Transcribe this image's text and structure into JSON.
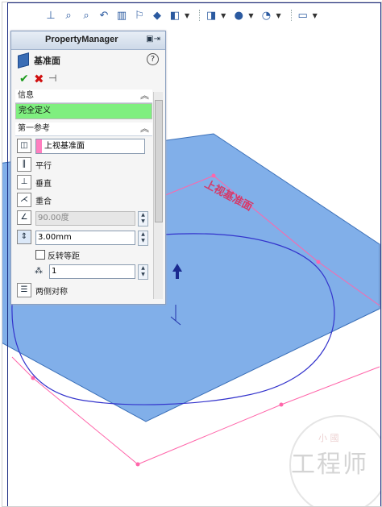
{
  "toolbar": {
    "icons": [
      "view-orientation-icon",
      "zoom-fit-icon",
      "zoom-area-icon",
      "previous-view-icon",
      "section-view-icon",
      "dynamic-annotation-icon",
      "view-orientation-cube-icon",
      "display-style-icon",
      "hide-show-icon",
      "edit-appearance-icon",
      "apply-scene-icon",
      "view-settings-icon"
    ]
  },
  "pm": {
    "title": "PropertyManager",
    "feature_name": "基准面",
    "help": "?",
    "info_section": "信息",
    "info_status": "完全定义",
    "first_ref_section": "第一参考",
    "reference_value": "上视基准面",
    "options": {
      "parallel": "平行",
      "perpendicular": "垂直",
      "coincident": "重合"
    },
    "angle_value": "90.00度",
    "offset_value": "3.00mm",
    "flip_offset": "反转等距",
    "count_value": "1",
    "mid_plane": "两侧对称"
  },
  "viewport": {
    "plane_label": "上视基准面"
  },
  "watermark": {
    "main": "工程师",
    "small": "小 國"
  },
  "colors": {
    "plane_fill": "#7aabe8",
    "plane_stroke": "#3a6fb8",
    "preview_line": "#ff66aa",
    "sketch_curve": "#3333cc",
    "fully_defined": "#7fef7f"
  }
}
